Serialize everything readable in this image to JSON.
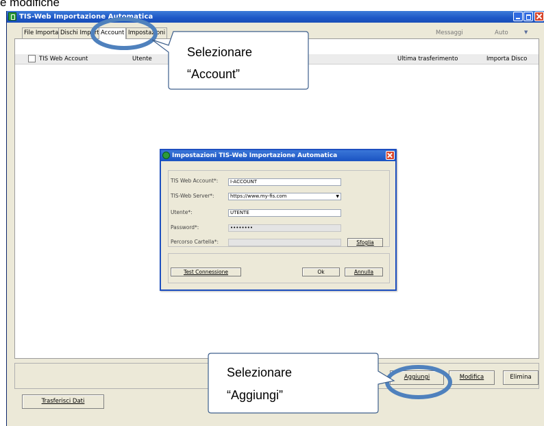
{
  "doc_caption": "e modifiche",
  "window": {
    "title": "TIS-Web Importazione Automatica"
  },
  "tabs": [
    {
      "label": "File Importati"
    },
    {
      "label": "Dischi Importati"
    },
    {
      "label": "Account",
      "active": true
    },
    {
      "label": "Impostazioni"
    }
  ],
  "toolbar": {
    "messages_label": "Messaggi",
    "mode_select_value": "Auto"
  },
  "table": {
    "columns": [
      "TIS Web Account",
      "Utente",
      "Ultima trasferimento",
      "Importa Disco"
    ],
    "rows": []
  },
  "dialog": {
    "title": "Impostazioni TIS-Web Importazione Automatica",
    "fields": [
      {
        "label": "TIS Web Account*:",
        "value": "I-ACCOUNT"
      },
      {
        "label": "TIS-Web Server*:",
        "value": "https://www.my-fis.com"
      },
      {
        "label": "Utente*:",
        "value": "UTENTE"
      },
      {
        "label": "Password*:",
        "value": "••••••••"
      },
      {
        "label": "Percorso Cartella*:",
        "value": ""
      }
    ],
    "browse_button": "Sfoglia",
    "test_button": "Test Connessione",
    "ok_button": "Ok",
    "cancel_button": "Annulla"
  },
  "buttons": {
    "add": "Aggiungi",
    "edit": "Modifica",
    "delete": "Elimina",
    "transfer": "Trasferisci Dati"
  },
  "callouts": {
    "account": [
      "Selezionare",
      "“Account”"
    ],
    "add": [
      "Selezionare",
      "“Aggiungi”"
    ]
  },
  "colors": {
    "titlebar": "#1c56c6",
    "callout_ring": "#4f81bd",
    "close_button": "#d8452b"
  }
}
